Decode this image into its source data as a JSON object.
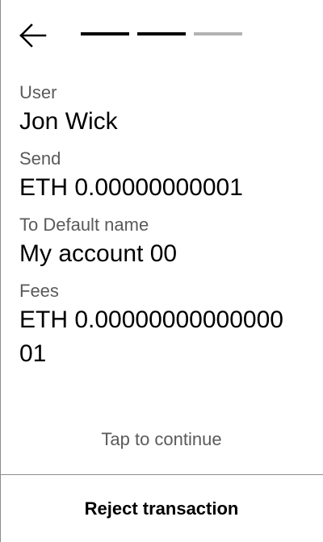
{
  "header": {
    "back_icon": "arrow-left-icon",
    "progress": {
      "total_steps": 3,
      "completed_steps": 2
    }
  },
  "details": {
    "user_label": "User",
    "user_value": "Jon Wick",
    "send_label": "Send",
    "send_value": "ETH 0.00000000001",
    "to_label": "To Default name",
    "to_value": "My account 00",
    "fees_label": "Fees",
    "fees_value": "ETH 0.0000000000000001"
  },
  "actions": {
    "tap_continue": "Tap to continue",
    "reject": "Reject transaction"
  },
  "colors": {
    "progress_active": "#000000",
    "progress_inactive": "#b3b3b3",
    "label": "#5a5a5a",
    "divider": "#8c8c8c"
  }
}
